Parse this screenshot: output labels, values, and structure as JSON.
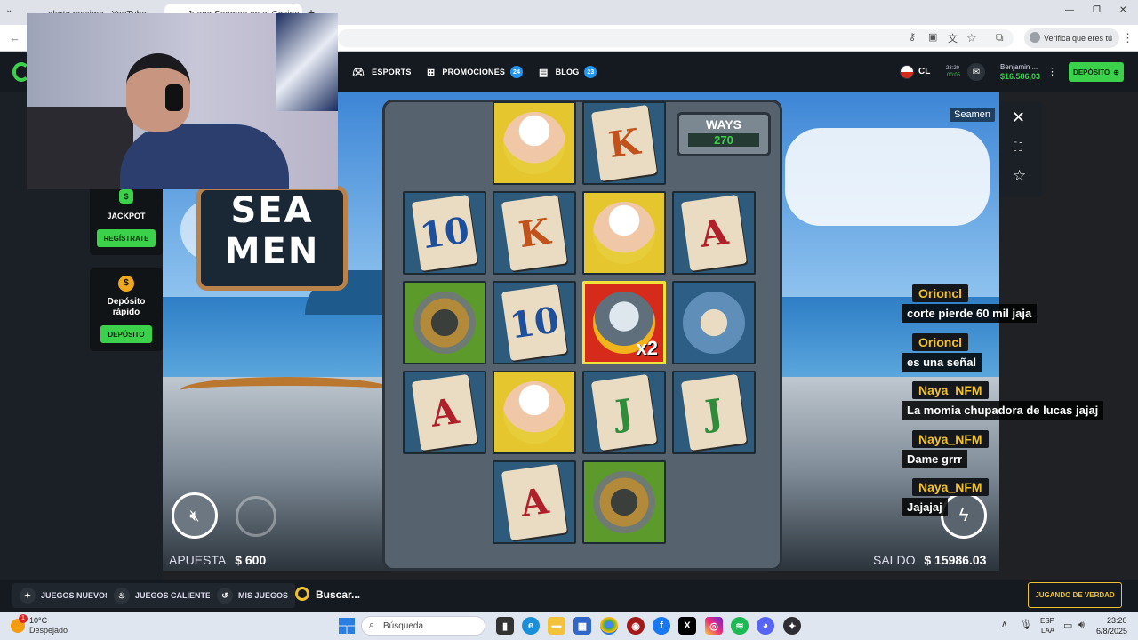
{
  "browser": {
    "tabs": [
      {
        "title": "alerta maxima - YouTube"
      },
      {
        "title": "Juega Seamen en el Casino Co..."
      }
    ],
    "new_tab": "+",
    "verify_label": "Verifica que eres tú",
    "window_controls": [
      "—",
      "❐",
      "✕"
    ]
  },
  "site": {
    "nav": [
      {
        "label": "ESPORTS"
      },
      {
        "label": "PROMOCIONES",
        "badge": "24"
      },
      {
        "label": "BLOG",
        "badge": "23"
      }
    ],
    "country": "CL",
    "time": "23:20",
    "time_sub": "00:05",
    "user_name": "Benjamin ...",
    "balance": "$16.586,03",
    "deposit_label": "DEPÓSITO"
  },
  "sidebar": {
    "jackpot_label": "JACKPOT",
    "register_label": "REGÍSTRATE",
    "fast_deposit_label": "Depósito rápido",
    "deposit_label": "DEPÓSITO"
  },
  "game": {
    "provider_tag": "Seamen",
    "logo_line1": "SEA",
    "logo_line2": "MEN",
    "ways_label": "WAYS",
    "ways_value": "270",
    "multiplier": "x2",
    "bet_label": "APUESTA",
    "bet_value": "$ 600",
    "balance_label": "SALDO",
    "balance_value": "$ 15986.03",
    "grid": [
      [
        null,
        {
          "t": "sailor"
        },
        {
          "t": "card",
          "v": "K",
          "c": "#c2521c"
        },
        null
      ],
      [
        {
          "t": "card",
          "v": "10",
          "c": "#1e4f9c"
        },
        {
          "t": "card",
          "v": "K",
          "c": "#c2521c"
        },
        {
          "t": "sailor"
        },
        {
          "t": "card",
          "v": "A",
          "c": "#b0202a"
        }
      ],
      [
        {
          "t": "helmet"
        },
        {
          "t": "card",
          "v": "10",
          "c": "#1e4f9c"
        },
        {
          "t": "shark"
        },
        {
          "t": "ship"
        }
      ],
      [
        {
          "t": "card",
          "v": "A",
          "c": "#b0202a"
        },
        {
          "t": "sailor"
        },
        {
          "t": "card",
          "v": "J",
          "c": "#2f8c3a"
        },
        {
          "t": "card",
          "v": "J",
          "c": "#2f8c3a"
        }
      ],
      [
        null,
        {
          "t": "card",
          "v": "A",
          "c": "#b0202a"
        },
        {
          "t": "helmet"
        },
        null
      ]
    ]
  },
  "chat": [
    {
      "user": "Orioncl",
      "msg": "corte pierde 60 mil jaja"
    },
    {
      "user": "Orioncl",
      "msg": "es una señal"
    },
    {
      "user": "Naya_NFM",
      "msg": "La momia chupadora de lucas jajaj"
    },
    {
      "user": "Naya_NFM",
      "msg": "Dame grrr"
    },
    {
      "user": "Naya_NFM",
      "msg": "Jajajaj"
    }
  ],
  "bottom_nav": [
    {
      "label": "JUEGOS NUEVOS"
    },
    {
      "label": "JUEGOS CALIENTES"
    },
    {
      "label": "MIS JUEGOS"
    }
  ],
  "search_placeholder": "Buscar...",
  "real_play_label": "JUGANDO DE VERDAD",
  "taskbar": {
    "weather_temp": "10°C",
    "weather_desc": "Despejado",
    "search_placeholder": "Búsqueda",
    "lang": "ESP",
    "lang_sub": "LAA",
    "clock_time": "23:20",
    "clock_date": "6/8/2025",
    "notif": "1"
  }
}
